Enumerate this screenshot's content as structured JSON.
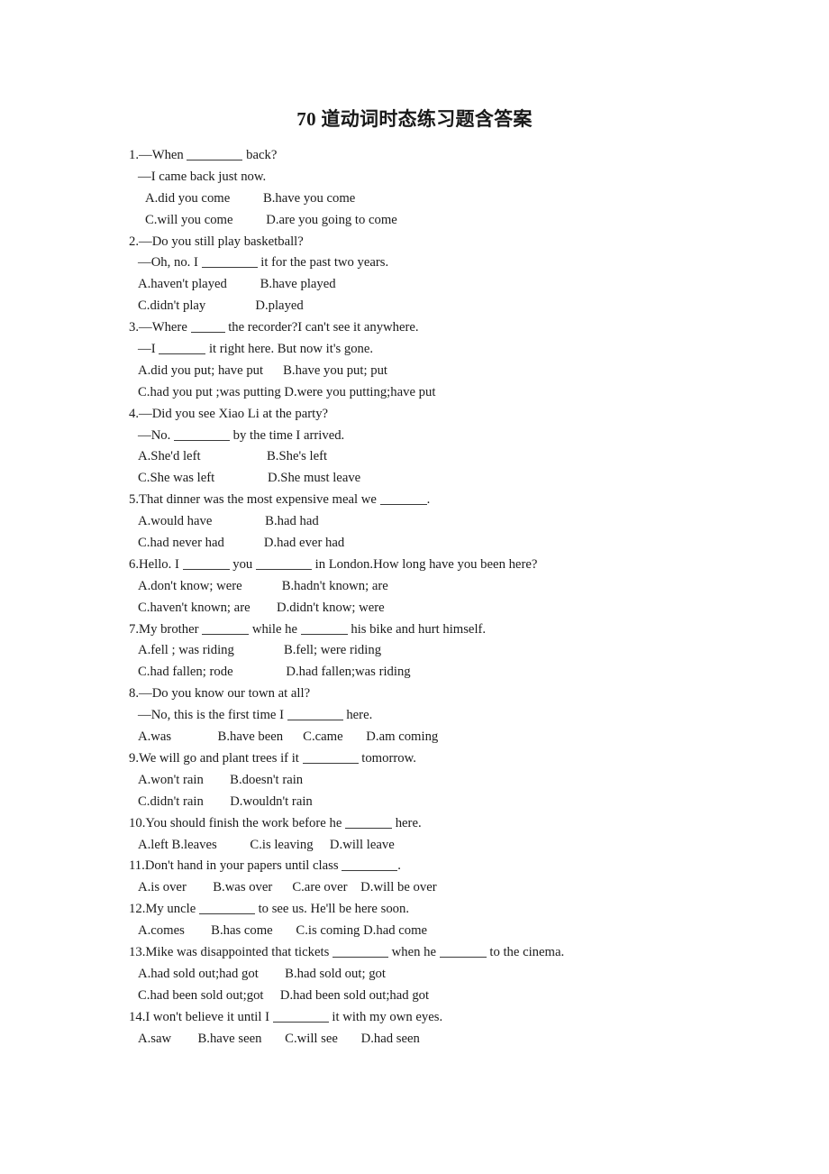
{
  "document": {
    "title": "70 道动词时态练习题含答案",
    "page_background": "#ffffff",
    "text_color": "#1a1a1a"
  },
  "questions": [
    {
      "number": "1.",
      "lines": [
        {
          "indent": 0,
          "segments": [
            {
              "t": "1.—When "
            },
            {
              "blank": "md"
            },
            {
              "t": " back?"
            }
          ]
        },
        {
          "indent": 1,
          "segments": [
            {
              "t": "—I came back just now."
            }
          ]
        },
        {
          "indent": 2,
          "segments": [
            {
              "t": "A.did you come          B.have you come"
            }
          ]
        },
        {
          "indent": 2,
          "segments": [
            {
              "t": "C.will you come          D.are you going to come"
            }
          ]
        }
      ]
    },
    {
      "number": "2.",
      "lines": [
        {
          "indent": 0,
          "segments": [
            {
              "t": "2.—Do you still play basketball?"
            }
          ]
        },
        {
          "indent": 1,
          "segments": [
            {
              "t": "—Oh, no. I "
            },
            {
              "blank": "md"
            },
            {
              "t": " it for the past two years."
            }
          ]
        },
        {
          "indent": 1,
          "segments": [
            {
              "t": "A.haven't played          B.have played"
            }
          ]
        },
        {
          "indent": 1,
          "segments": [
            {
              "t": "C.didn't play               D.played"
            }
          ]
        }
      ]
    },
    {
      "number": "3.",
      "lines": [
        {
          "indent": 0,
          "segments": [
            {
              "t": "3.—Where "
            },
            {
              "blank": "xs"
            },
            {
              "t": " the recorder?I can't see it anywhere."
            }
          ]
        },
        {
          "indent": 1,
          "segments": [
            {
              "t": "—I "
            },
            {
              "blank": "sm"
            },
            {
              "t": " it right here. But now it's gone."
            }
          ]
        },
        {
          "indent": 1,
          "segments": [
            {
              "t": "A.did you put; have put      B.have you put; put"
            }
          ]
        },
        {
          "indent": 1,
          "segments": [
            {
              "t": "C.had you put ;was putting D.were you putting;have put"
            }
          ]
        }
      ]
    },
    {
      "number": "4.",
      "lines": [
        {
          "indent": 0,
          "segments": [
            {
              "t": "4.—Did you see Xiao Li at the party?"
            }
          ]
        },
        {
          "indent": 1,
          "segments": [
            {
              "t": "—No. "
            },
            {
              "blank": "md"
            },
            {
              "t": " by the time I arrived."
            }
          ]
        },
        {
          "indent": 1,
          "segments": [
            {
              "t": "A.She'd left                    B.She's left"
            }
          ]
        },
        {
          "indent": 1,
          "segments": [
            {
              "t": "C.She was left                D.She must leave"
            }
          ]
        }
      ]
    },
    {
      "number": "5.",
      "lines": [
        {
          "indent": 0,
          "segments": [
            {
              "t": "5.That dinner was the most expensive meal we "
            },
            {
              "blank": "sm"
            },
            {
              "t": "."
            }
          ]
        },
        {
          "indent": 1,
          "segments": [
            {
              "t": "A.would have                B.had had"
            }
          ]
        },
        {
          "indent": 1,
          "segments": [
            {
              "t": "C.had never had            D.had ever had"
            }
          ]
        }
      ]
    },
    {
      "number": "6.",
      "lines": [
        {
          "indent": 0,
          "segments": [
            {
              "t": "6.Hello. I "
            },
            {
              "blank": "sm"
            },
            {
              "t": " you "
            },
            {
              "blank": "md"
            },
            {
              "t": " in London.How long have you been here?"
            }
          ]
        },
        {
          "indent": 1,
          "segments": [
            {
              "t": "A.don't know; were            B.hadn't known; are"
            }
          ]
        },
        {
          "indent": 1,
          "segments": [
            {
              "t": "C.haven't known; are        D.didn't know; were"
            }
          ]
        }
      ]
    },
    {
      "number": "7.",
      "lines": [
        {
          "indent": 0,
          "segments": [
            {
              "t": "7.My brother "
            },
            {
              "blank": "sm"
            },
            {
              "t": " while he "
            },
            {
              "blank": "sm"
            },
            {
              "t": " his bike and hurt himself."
            }
          ]
        },
        {
          "indent": 1,
          "segments": [
            {
              "t": "A.fell ; was riding               B.fell; were riding"
            }
          ]
        },
        {
          "indent": 1,
          "segments": [
            {
              "t": "C.had fallen; rode                D.had fallen;was riding"
            }
          ]
        }
      ]
    },
    {
      "number": "8.",
      "lines": [
        {
          "indent": 0,
          "segments": [
            {
              "t": "8.—Do you know our town at all?"
            }
          ]
        },
        {
          "indent": 1,
          "segments": [
            {
              "t": "—No, this is the first time I "
            },
            {
              "blank": "md"
            },
            {
              "t": " here."
            }
          ]
        },
        {
          "indent": 1,
          "segments": [
            {
              "t": "A.was              B.have been      C.came       D.am coming"
            }
          ]
        }
      ]
    },
    {
      "number": "9.",
      "lines": [
        {
          "indent": 0,
          "segments": [
            {
              "t": "9.We will go and plant trees if it "
            },
            {
              "blank": "md"
            },
            {
              "t": " tomorrow."
            }
          ]
        },
        {
          "indent": 1,
          "segments": [
            {
              "t": "A.won't rain        B.doesn't rain"
            }
          ]
        },
        {
          "indent": 1,
          "segments": [
            {
              "t": "C.didn't rain        D.wouldn't rain"
            }
          ]
        }
      ]
    },
    {
      "number": "10.",
      "lines": [
        {
          "indent": 0,
          "segments": [
            {
              "t": "10.You should finish the work before he "
            },
            {
              "blank": "sm"
            },
            {
              "t": " here."
            }
          ]
        },
        {
          "indent": 1,
          "segments": [
            {
              "t": "A.left B.leaves          C.is leaving     D.will leave"
            }
          ]
        }
      ]
    },
    {
      "number": "11.",
      "lines": [
        {
          "indent": 0,
          "segments": [
            {
              "t": "11.Don't hand in your papers until class "
            },
            {
              "blank": "md"
            },
            {
              "t": "."
            }
          ]
        },
        {
          "indent": 1,
          "segments": [
            {
              "t": "A.is over        B.was over      C.are over    D.will be over"
            }
          ]
        }
      ]
    },
    {
      "number": "12.",
      "lines": [
        {
          "indent": 0,
          "segments": [
            {
              "t": "12.My uncle "
            },
            {
              "blank": "md"
            },
            {
              "t": " to see us. He'll be here soon."
            }
          ]
        },
        {
          "indent": 1,
          "segments": [
            {
              "t": "A.comes        B.has come       C.is coming D.had come"
            }
          ]
        }
      ]
    },
    {
      "number": "13.",
      "lines": [
        {
          "indent": 0,
          "segments": [
            {
              "t": "13.Mike was disappointed that tickets "
            },
            {
              "blank": "md"
            },
            {
              "t": " when he "
            },
            {
              "blank": "sm"
            },
            {
              "t": " to the cinema."
            }
          ]
        },
        {
          "indent": 1,
          "segments": [
            {
              "t": "A.had sold out;had got        B.had sold out; got"
            }
          ]
        },
        {
          "indent": 1,
          "segments": [
            {
              "t": "C.had been sold out;got     D.had been sold out;had got"
            }
          ]
        }
      ]
    },
    {
      "number": "14.",
      "lines": [
        {
          "indent": 0,
          "segments": [
            {
              "t": "14.I won't believe it until I "
            },
            {
              "blank": "md"
            },
            {
              "t": " it with my own eyes."
            }
          ]
        },
        {
          "indent": 1,
          "segments": [
            {
              "t": "A.saw        B.have seen       C.will see       D.had seen"
            }
          ]
        }
      ]
    }
  ]
}
